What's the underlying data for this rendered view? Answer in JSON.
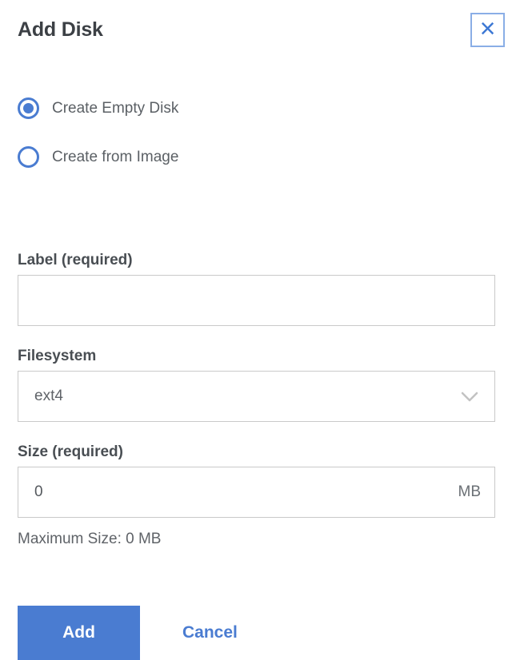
{
  "dialog": {
    "title": "Add Disk"
  },
  "icons": {
    "close": "×",
    "chevron_down": "chevron-down"
  },
  "radio_group": {
    "options": [
      {
        "label": "Create Empty Disk",
        "selected": true
      },
      {
        "label": "Create from Image",
        "selected": false
      }
    ]
  },
  "fields": {
    "label": {
      "label": "Label (required)",
      "value": ""
    },
    "filesystem": {
      "label": "Filesystem",
      "selected_option": "ext4"
    },
    "size": {
      "label": "Size (required)",
      "value": "0",
      "unit": "MB",
      "helper_text": "Maximum Size: 0 MB"
    }
  },
  "actions": {
    "add": "Add",
    "cancel": "Cancel"
  },
  "colors": {
    "accent_blue": "#4a7cd1",
    "close_icon_blue": "#3d78d4",
    "close_border_blue": "#8aaee6",
    "input_border": "#c9c9c9",
    "label_text": "#494e53",
    "body_text": "#5f6368"
  }
}
